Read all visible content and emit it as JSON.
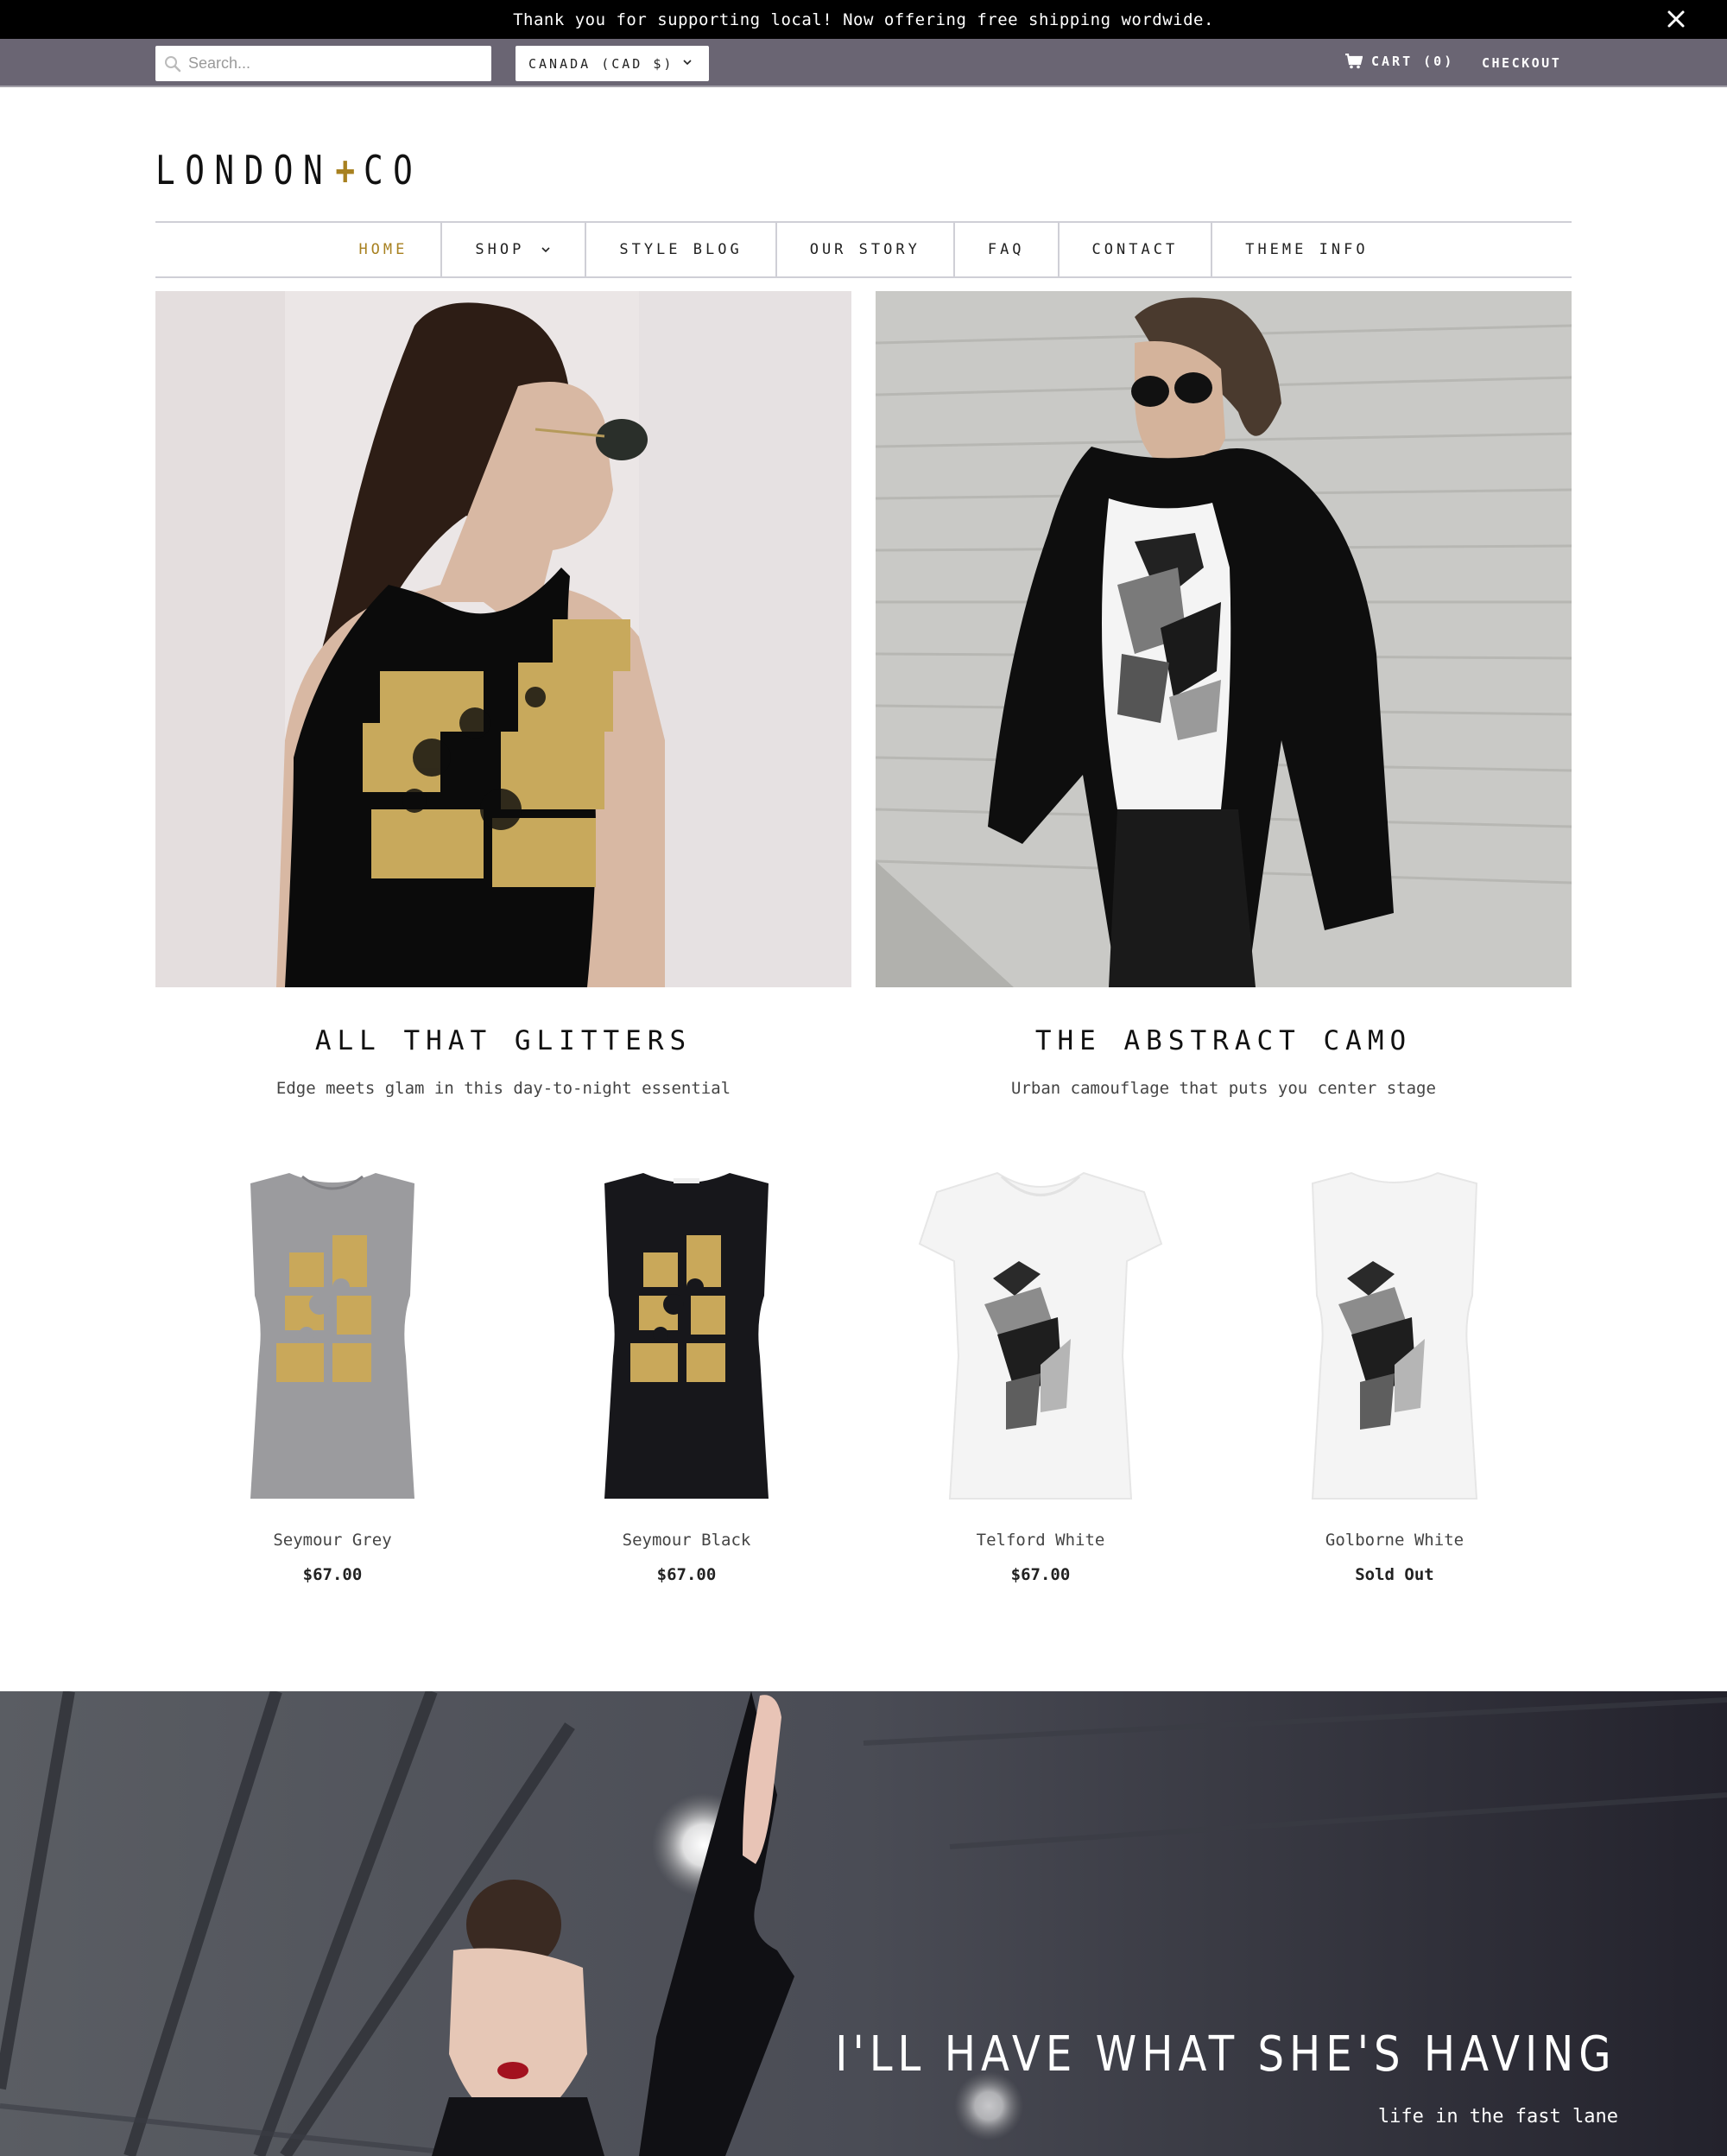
{
  "announcement": {
    "text": "Thank you for supporting local! Now offering free shipping wordwide.",
    "close_icon": "close-icon"
  },
  "topbar": {
    "search_placeholder": "Search...",
    "search_value": "",
    "currency_selected": "CANADA (CAD $)",
    "cart_label": "CART (0)",
    "cart_count": 0,
    "checkout_label": "CHECKOUT"
  },
  "brand": {
    "logo_left": "LONDON",
    "logo_plus": "+",
    "logo_right": "CO",
    "accent_color": "#a88120"
  },
  "nav": {
    "items": [
      {
        "label": "HOME",
        "active": true
      },
      {
        "label": "SHOP",
        "has_dropdown": true
      },
      {
        "label": "STYLE BLOG"
      },
      {
        "label": "OUR STORY"
      },
      {
        "label": "FAQ"
      },
      {
        "label": "CONTACT"
      },
      {
        "label": "THEME INFO"
      }
    ]
  },
  "featured": [
    {
      "title": "ALL THAT GLITTERS",
      "subtitle": "Edge meets glam in this day-to-night essential",
      "image": "woman in black sleeveless tee with gold foil print"
    },
    {
      "title": "THE ABSTRACT CAMO",
      "subtitle": "Urban camouflage that puts you center stage",
      "image": "woman in white tee with abstract grey camo print and black bomber jacket"
    }
  ],
  "products": [
    {
      "name": "Seymour Grey",
      "price": "$67.00",
      "image": "grey sleeveless tee with gold foil print"
    },
    {
      "name": "Seymour Black",
      "price": "$67.00",
      "image": "black sleeveless tee with gold foil print"
    },
    {
      "name": "Telford White",
      "price": "$67.00",
      "image": "white short-sleeve tee with abstract camo print"
    },
    {
      "name": "Golborne White",
      "price": "Sold Out",
      "image": "white sleeveless tee with abstract camo print"
    }
  ],
  "banner": {
    "headline": "I'LL HAVE WHAT SHE'S HAVING",
    "tagline": "life in the fast lane"
  }
}
